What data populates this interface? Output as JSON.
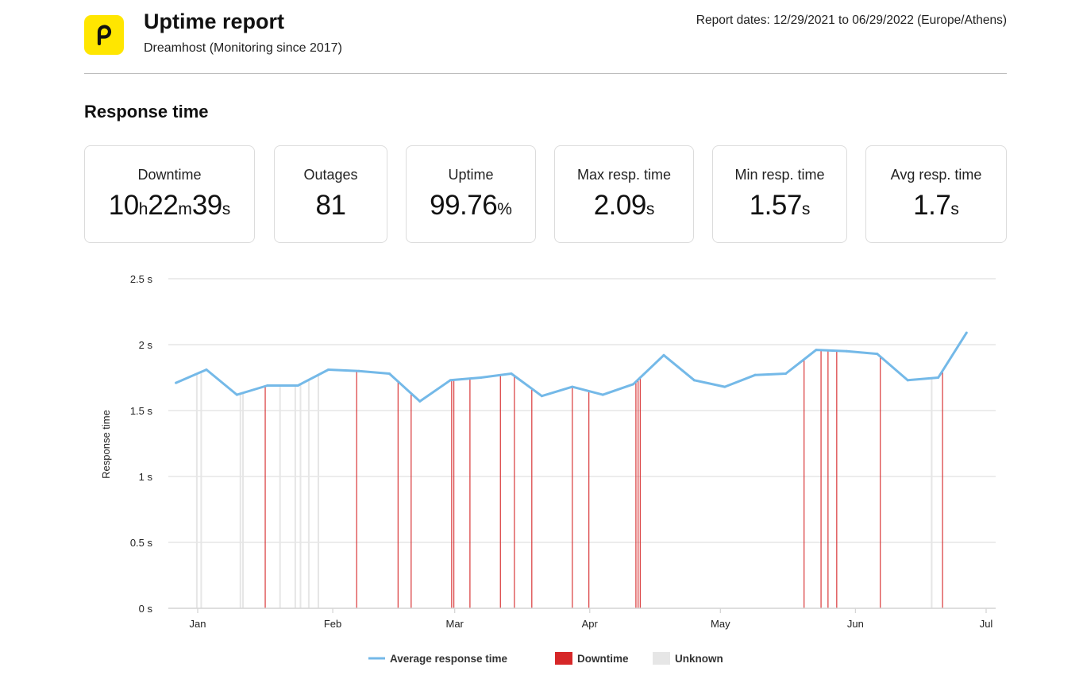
{
  "header": {
    "logo_icon": "p-logo",
    "title": "Uptime report",
    "subtitle": "Dreamhost (Monitoring since 2017)",
    "report_dates": "Report dates: 12/29/2021 to 06/29/2022 (Europe/Athens)"
  },
  "section_title": "Response time",
  "stats": [
    {
      "label": "Downtime",
      "parts": [
        {
          "n": "10",
          "u": "h"
        },
        {
          "n": "22",
          "u": "m"
        },
        {
          "n": "39",
          "u": "s"
        }
      ]
    },
    {
      "label": "Outages",
      "parts": [
        {
          "n": "81",
          "u": ""
        }
      ]
    },
    {
      "label": "Uptime",
      "parts": [
        {
          "n": "99.76",
          "u": "%"
        }
      ]
    },
    {
      "label": "Max resp. time",
      "parts": [
        {
          "n": "2.09",
          "u": "s"
        }
      ]
    },
    {
      "label": "Min resp. time",
      "parts": [
        {
          "n": "1.57",
          "u": "s"
        }
      ]
    },
    {
      "label": "Avg resp. time",
      "parts": [
        {
          "n": "1.7",
          "u": "s"
        }
      ]
    }
  ],
  "colors": {
    "line": "#74b9e8",
    "downtime": "#d62728",
    "unknown": "#e6e6e6",
    "grid": "#e0e0e0",
    "logo": "#ffe600"
  },
  "chart_data": {
    "type": "line",
    "title": "",
    "xlabel": "",
    "ylabel": "Response time",
    "ylim": [
      0,
      2.5
    ],
    "yticks": [
      0,
      0.5,
      1,
      1.5,
      2,
      2.5
    ],
    "ytick_labels": [
      "0  s",
      "0.5  s",
      "1  s",
      "1.5  s",
      "2  s",
      "2.5  s"
    ],
    "x_range_days": [
      -4.4,
      182
    ],
    "xticks": [
      {
        "label": "Jan",
        "day": 0
      },
      {
        "label": "Feb",
        "day": 31
      },
      {
        "label": "Mar",
        "day": 59
      },
      {
        "label": "Apr",
        "day": 90
      },
      {
        "label": "May",
        "day": 120
      },
      {
        "label": "Jun",
        "day": 151
      },
      {
        "label": "Jul",
        "day": 181
      }
    ],
    "grid": true,
    "legend_position": "bottom-center",
    "series": [
      {
        "name": "Average response time",
        "type": "line",
        "x_days": [
          -5,
          2,
          9,
          16,
          23,
          30,
          37,
          44,
          51,
          58,
          65,
          72,
          79,
          86,
          93,
          100,
          107,
          114,
          121,
          128,
          135,
          142,
          149,
          156,
          163,
          170,
          176.5
        ],
        "values": [
          1.71,
          1.81,
          1.62,
          1.69,
          1.69,
          1.81,
          1.8,
          1.78,
          1.57,
          1.73,
          1.75,
          1.78,
          1.61,
          1.68,
          1.62,
          1.7,
          1.92,
          1.73,
          1.68,
          1.77,
          1.78,
          1.96,
          1.95,
          1.93,
          1.73,
          1.75,
          2.09
        ]
      }
    ],
    "downtime_days": [
      15.5,
      36.5,
      46,
      49,
      58.3,
      58.8,
      62.5,
      69.5,
      72.7,
      76.7,
      86,
      89.8,
      100.6,
      101.1,
      101.6,
      139.2,
      143.1,
      144.7,
      146.7,
      156.7,
      171
    ],
    "unknown_days": [
      -0.2,
      0.8,
      9.8,
      10.4,
      18.9,
      22.4,
      23.6,
      25.5,
      27.7,
      168.5
    ],
    "legend": [
      {
        "label": "Average response time",
        "kind": "line"
      },
      {
        "label": "Downtime",
        "kind": "box"
      },
      {
        "label": "Unknown",
        "kind": "box"
      }
    ]
  }
}
